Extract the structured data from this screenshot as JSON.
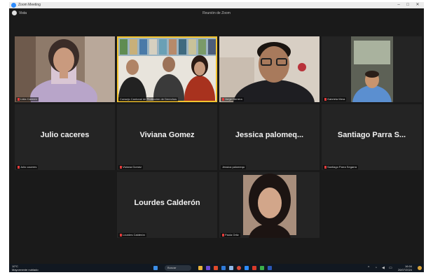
{
  "window": {
    "title": "Zoom Meeting",
    "min": "–",
    "max": "□",
    "close": "✕"
  },
  "topbar": {
    "view_label": "Vista",
    "meeting_title": "Reunión de Zoom"
  },
  "tiles": [
    {
      "label": "Lidia Carmen",
      "mic_muted": true
    },
    {
      "label": "Consejo Cantonal de Protección de Derechos",
      "mic_muted": false,
      "active": true
    },
    {
      "label": "Jorge Herrera",
      "mic_muted": true
    },
    {
      "label": "Gabriela Mera",
      "mic_muted": true
    },
    {
      "name": "Julio caceres",
      "label": "Julio caceres",
      "mic_muted": true
    },
    {
      "name": "Viviana Gomez",
      "label": "Viviana Gomez",
      "mic_muted": true
    },
    {
      "name": "Jessica  palomeq...",
      "label": "Jessica palomequ",
      "mic_muted": false
    },
    {
      "name": "Santiago Parra S...",
      "label": "Santiago Parra Segarra",
      "mic_muted": true
    },
    {
      "name": "Lourdes Calderón",
      "label": "Lourdes Calderón",
      "mic_muted": true
    },
    {
      "label": "Paola Ortiz",
      "mic_muted": true
    }
  ],
  "taskbar": {
    "weather_temp": "10°C",
    "weather_desc": "Mayormente nublado",
    "search_placeholder": "Buscar",
    "time": "16:04",
    "date": "26/07/2024"
  },
  "colors": {
    "active_speaker": "#f4c430",
    "muted_mic": "#e23b3b",
    "zoom_blue": "#2d8cff"
  }
}
